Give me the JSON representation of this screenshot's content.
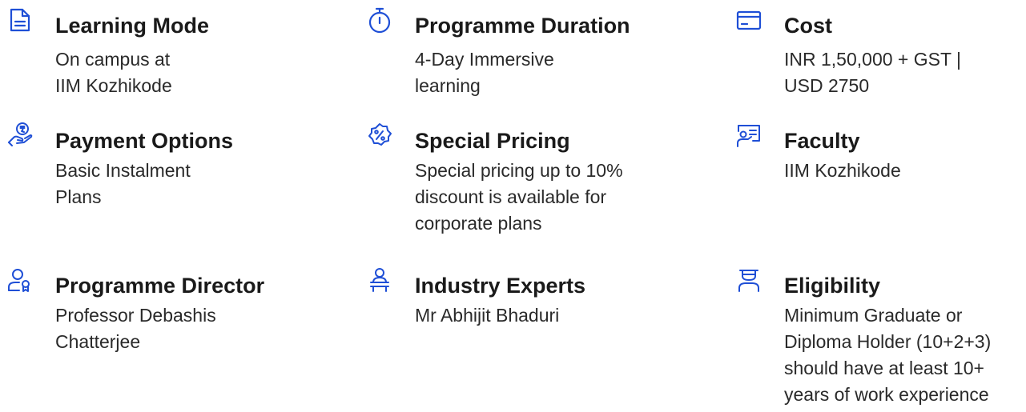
{
  "colors": {
    "accent": "#1f4fd6",
    "title": "#1a1a1a",
    "text": "#2a2a2a"
  },
  "items": [
    {
      "icon": "document-icon",
      "title": "Learning Mode",
      "desc": [
        "On campus at",
        "IIM Kozhikode"
      ]
    },
    {
      "icon": "stopwatch-icon",
      "title": "Programme Duration",
      "desc": [
        "4-Day Immersive",
        "learning"
      ]
    },
    {
      "icon": "card-icon",
      "title": "Cost",
      "desc": [
        "INR 1,50,000 + GST |",
        "USD 2750"
      ]
    },
    {
      "icon": "payment-hand-icon",
      "title": "Payment Options",
      "desc": [
        "Basic Instalment",
        "Plans"
      ]
    },
    {
      "icon": "discount-badge-icon",
      "title": "Special Pricing",
      "desc": [
        "Special pricing up to 10%",
        "discount is available for",
        "corporate plans"
      ]
    },
    {
      "icon": "faculty-board-icon",
      "title": "Faculty",
      "desc": [
        "IIM Kozhikode"
      ]
    },
    {
      "icon": "director-icon",
      "title": "Programme Director",
      "desc": [
        "Professor Debashis",
        "Chatterjee"
      ]
    },
    {
      "icon": "presenter-icon",
      "title": "Industry Experts",
      "desc": [
        "Mr Abhijit Bhaduri"
      ]
    },
    {
      "icon": "graduate-icon",
      "title": "Eligibility",
      "desc": [
        "Minimum Graduate or",
        "Diploma Holder (10+2+3)",
        "should have at least 10+",
        "years of work experience"
      ]
    }
  ]
}
